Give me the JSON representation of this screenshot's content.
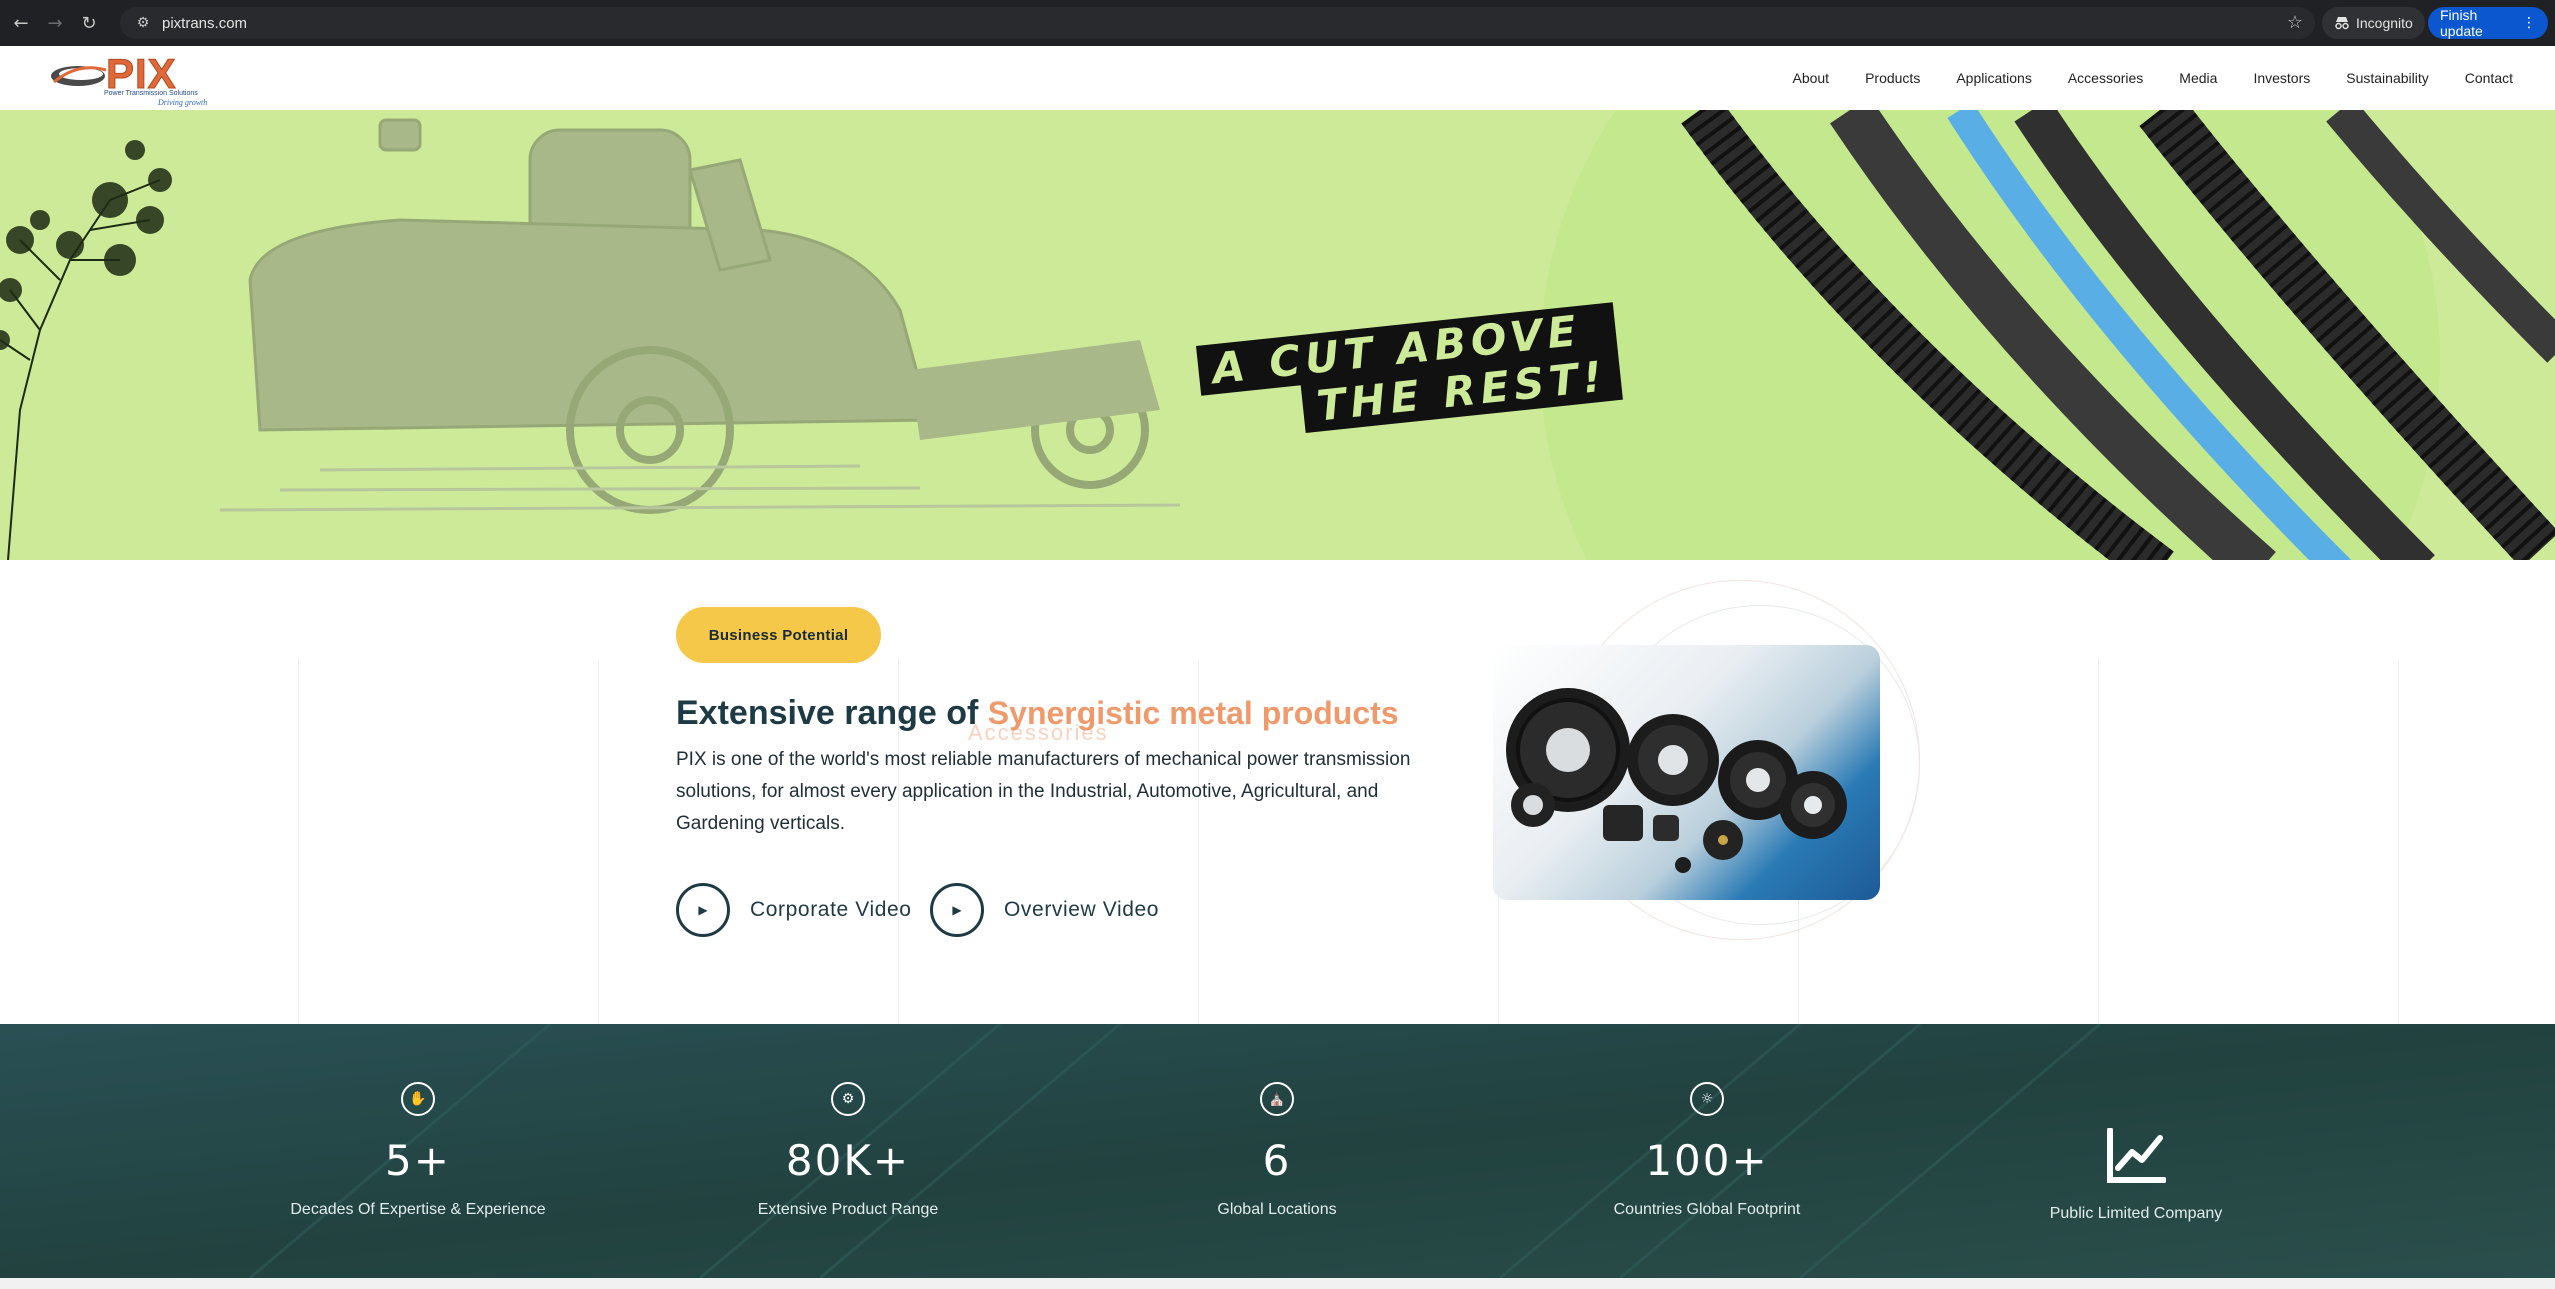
{
  "browser": {
    "url": "pixtrans.com",
    "incognito_label": "Incognito",
    "finish_update_label": "Finish update",
    "icons": [
      "back-arrow-icon",
      "forward-arrow-icon",
      "reload-icon",
      "site-settings-icon",
      "star-icon",
      "incognito-icon",
      "kebab-menu-icon"
    ]
  },
  "header": {
    "logo": {
      "name": "PIX",
      "subtitle": "Power Transmission Solutions",
      "tagline": "Driving growth"
    },
    "nav": [
      "About",
      "Products",
      "Applications",
      "Accessories",
      "Media",
      "Investors",
      "Sustainability",
      "Contact"
    ]
  },
  "hero": {
    "tagline_line1": "A CUT ABOVE",
    "tagline_line2": "THE REST!",
    "colors": {
      "background": "#cdea99",
      "belt_blue": "#5aaee6",
      "belt_dark": "#2b2b2b"
    }
  },
  "intro": {
    "badge": "Business Potential",
    "heading_prefix": "Extensive range of",
    "heading_accent": "Synergistic metal products",
    "heading_ghost": "Accessories",
    "body": "PIX is one of the world's most reliable manufacturers of mechanical power transmission solutions, for almost every application in the Industrial, Automotive, Agricultural, and Gardening verticals.",
    "videos": [
      {
        "label": "Corporate Video",
        "icon": "play-icon"
      },
      {
        "label": "Overview Video",
        "icon": "play-icon"
      }
    ]
  },
  "stats": [
    {
      "value": "5+",
      "label": "Decades Of Expertise & Experience",
      "icon": "expertise-icon"
    },
    {
      "value": "80K+",
      "label": "Extensive Product Range",
      "icon": "product-range-icon"
    },
    {
      "value": "6",
      "label": "Global Locations",
      "icon": "factory-icon"
    },
    {
      "value": "100+",
      "label": "Countries Global Footprint",
      "icon": "globe-icon"
    },
    {
      "value": "",
      "label": "Public Limited Company",
      "icon": "trend-chart-icon"
    }
  ],
  "colors": {
    "accent_yellow": "#f6c84a",
    "accent_orange": "#ee9a6c",
    "dark_teal": "#25474b",
    "text_dark": "#1e3a44"
  }
}
